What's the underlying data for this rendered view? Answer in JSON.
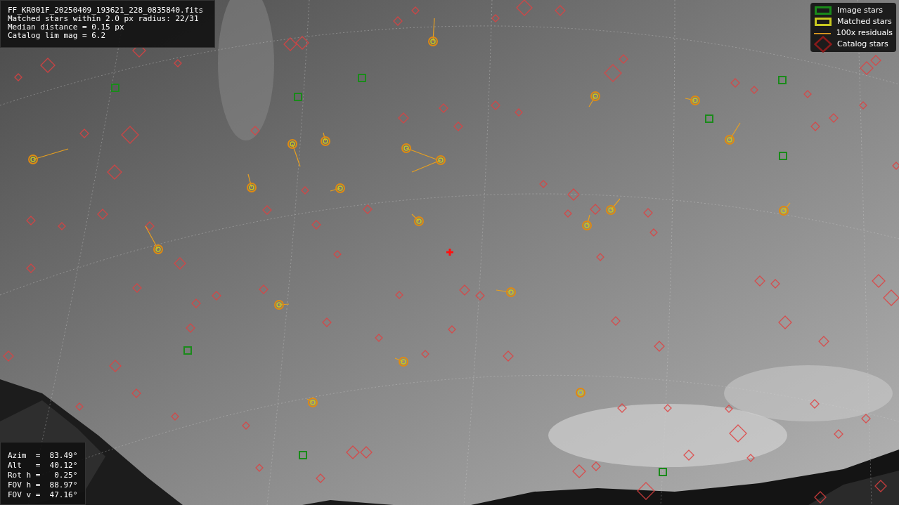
{
  "info_lines": [
    "FF_KR001F_20250409_193621_228_0835840.fits",
    "Matched stars within 2.0 px radius: 22/31",
    "Median distance = 0.15 px",
    "Catalog lim mag = 6.2"
  ],
  "legend": [
    {
      "kind": "box",
      "color": "#1a8a1a",
      "label": "Image stars"
    },
    {
      "kind": "box",
      "color": "#c8c820",
      "label": "Matched stars"
    },
    {
      "kind": "line",
      "color": "#e8a020",
      "label": "100x residuals"
    },
    {
      "kind": "diamond",
      "color": "#8b1a1a",
      "label": "Catalog stars"
    }
  ],
  "pointing_lines": [
    "Azim  =  83.49°",
    "Alt   =  40.12°",
    "Rot h =   0.25°",
    "FOV h =  88.97°",
    "FOV v =  47.16°"
  ]
}
